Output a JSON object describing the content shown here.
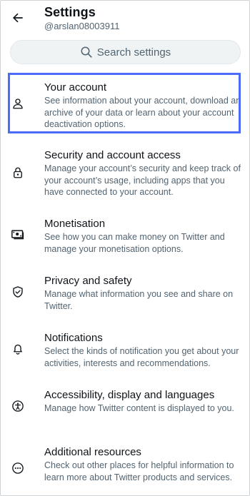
{
  "header": {
    "title": "Settings",
    "handle": "@arslan08003911"
  },
  "search": {
    "placeholder": "Search settings"
  },
  "items": [
    {
      "label": "Your account",
      "description": "See information about your account, download an archive of your data or learn about your account deactivation options.",
      "icon": "person-icon"
    },
    {
      "label": "Security and account access",
      "description": "Manage your account’s security and keep track of your account’s usage, including apps that you have connected to your account.",
      "icon": "lock-icon"
    },
    {
      "label": "Monetisation",
      "description": "See how you can make money on Twitter and manage your monetisation options.",
      "icon": "money-icon"
    },
    {
      "label": "Privacy and safety",
      "description": "Manage what information you see and share on Twitter.",
      "icon": "shield-icon"
    },
    {
      "label": "Notifications",
      "description": "Select the kinds of notification you get about your activities, interests and recommendations.",
      "icon": "bell-icon"
    },
    {
      "label": "Accessibility, display and languages",
      "description": "Manage how Twitter content is displayed to you.",
      "icon": "accessibility-icon"
    },
    {
      "label": "Additional resources",
      "description": "Check out other places for helpful information to learn more about Twitter products and services.",
      "icon": "more-icon"
    }
  ],
  "colors": {
    "highlight": "#4a6cf7",
    "secondary_text": "#536471",
    "search_bg": "#eff3f4"
  }
}
